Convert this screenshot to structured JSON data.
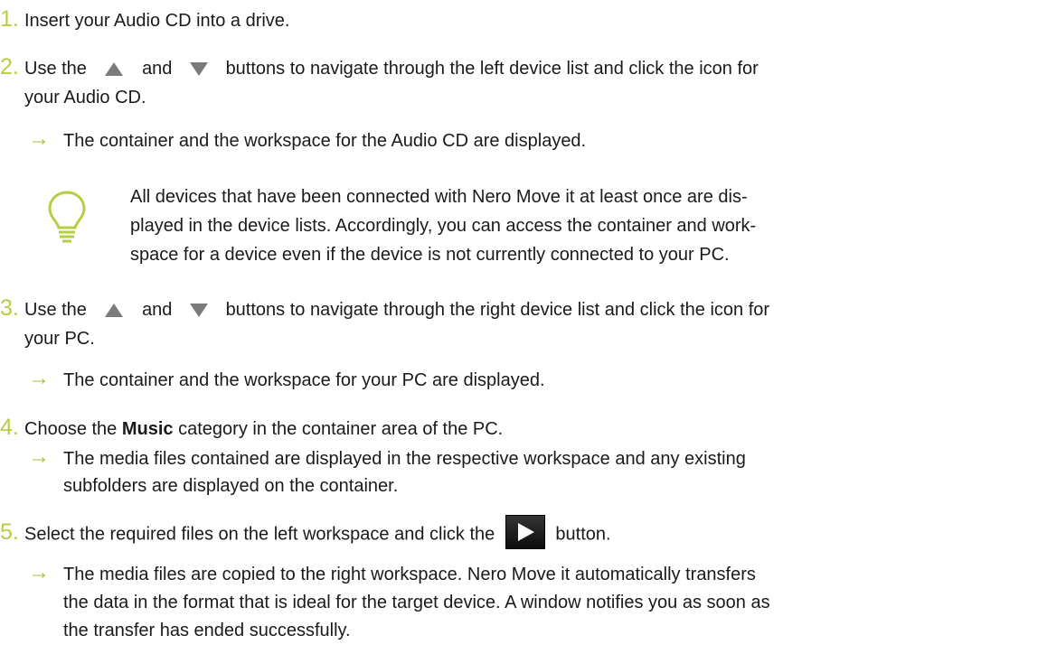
{
  "steps": [
    {
      "number": "1.",
      "text": "Insert your Audio CD into a drive."
    },
    {
      "number": "2.",
      "pre": "Use the",
      "and": "and",
      "post": "buttons to navigate through the left device list and click the icon for",
      "cont": "your Audio CD.",
      "result": "The container and the workspace for the Audio CD are displayed."
    },
    {
      "number": "3.",
      "pre": "Use the",
      "and": "and",
      "post": "buttons to navigate through the right device list and click the icon for",
      "cont": "your PC.",
      "result": "The container and the workspace for your PC are displayed."
    },
    {
      "number": "4.",
      "pre": "Choose the",
      "bold": "Music",
      "post": "category in the container area of the PC.",
      "result_1": "The media files contained are displayed in the respective workspace and any existing",
      "result_2": "subfolders are displayed on the container."
    },
    {
      "number": "5.",
      "pre": "Select the required files on the left workspace and click the",
      "post": "button.",
      "result_1": "The media files are copied to the right workspace. Nero Move it automatically transfers",
      "result_2": "the data in the format that is ideal for the target device. A window notifies you as soon as",
      "result_3": "the transfer has ended successfully."
    }
  ],
  "tip": {
    "line_1": "All devices that have been connected with Nero Move it at least once are dis-",
    "line_2": "played in the device lists. Accordingly, you can access the container and work-",
    "line_3": "space for a device even if the device is not currently connected to your PC."
  },
  "icons": {
    "up": "triangle-up-icon",
    "down": "triangle-down-icon",
    "arrow": "right-arrow-icon",
    "tip": "lightbulb-icon",
    "play": "play-icon"
  },
  "colors": {
    "accent": "#b5cf45",
    "arrow": "#a7c52f",
    "text": "#1a1a1a",
    "icon_gray": "#7b7b7b"
  }
}
